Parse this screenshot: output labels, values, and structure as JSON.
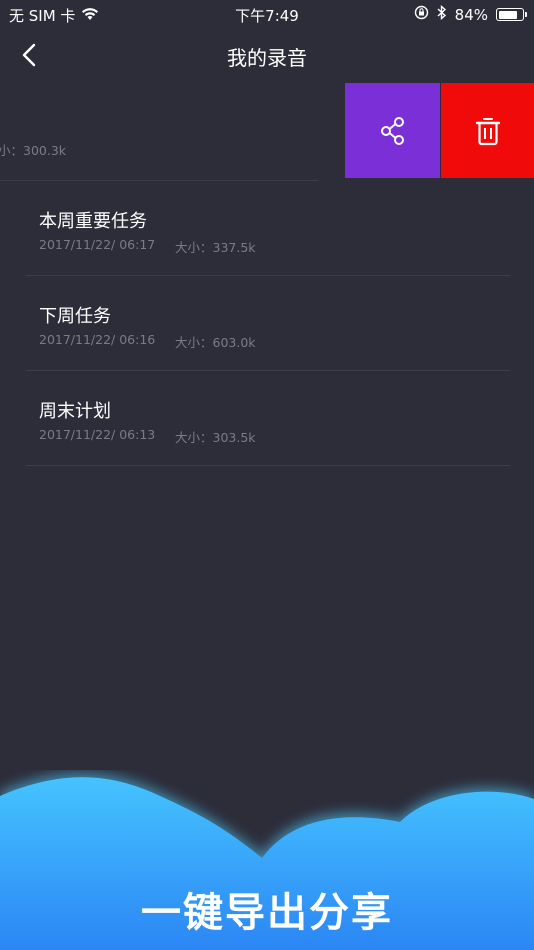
{
  "status_bar": {
    "carrier": "无 SIM 卡",
    "time": "下午7:49",
    "battery_text": "84%",
    "battery_level": 0.84
  },
  "nav": {
    "title": "我的录音"
  },
  "swiped_item": {
    "size": "小：300.3k"
  },
  "recordings": [
    {
      "name": "本周重要任务",
      "date": "2017/11/22/ 06:17",
      "size": "大小：337.5k"
    },
    {
      "name": "下周任务",
      "date": "2017/11/22/ 06:16",
      "size": "大小：603.0k"
    },
    {
      "name": "周末计划",
      "date": "2017/11/22/ 06:13",
      "size": "大小：303.5k"
    }
  ],
  "actions": {
    "share_color": "#7b2fd6",
    "delete_color": "#f00a0a"
  },
  "banner": {
    "text": "一键导出分享"
  }
}
